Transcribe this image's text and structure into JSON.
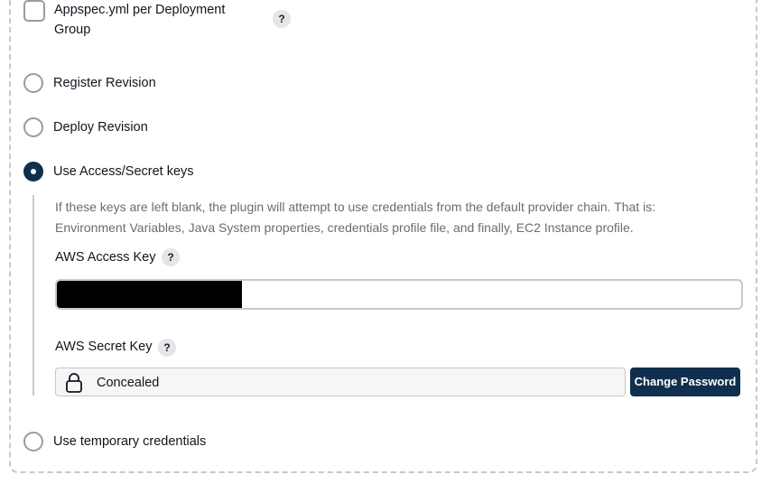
{
  "checkbox": {
    "label": "Appspec.yml per Deployment Group",
    "checked": false,
    "help": "?"
  },
  "radios": {
    "register": {
      "label": "Register Revision",
      "checked": false
    },
    "deploy": {
      "label": "Deploy Revision",
      "checked": false
    },
    "access_keys": {
      "label": "Use Access/Secret keys",
      "checked": true
    },
    "temporary": {
      "label": "Use temporary credentials",
      "checked": false
    }
  },
  "access_section": {
    "description": "If these keys are left blank, the plugin will attempt to use credentials from the default provider chain. That is: Environment Variables, Java System properties, credentials profile file, and finally, EC2 Instance profile.",
    "access_key_label": "AWS Access Key",
    "access_key_help": "?",
    "secret_key_label": "AWS Secret Key",
    "secret_key_help": "?",
    "secret_value": "Concealed",
    "change_password_label": "Change Password"
  },
  "colors": {
    "accent": "#0f2f4d",
    "border": "#c8c8ce",
    "muted_text": "#6b6b76"
  },
  "icons": {
    "help": "question-mark-icon",
    "lock": "lock-icon",
    "redaction": "redacted-block"
  }
}
